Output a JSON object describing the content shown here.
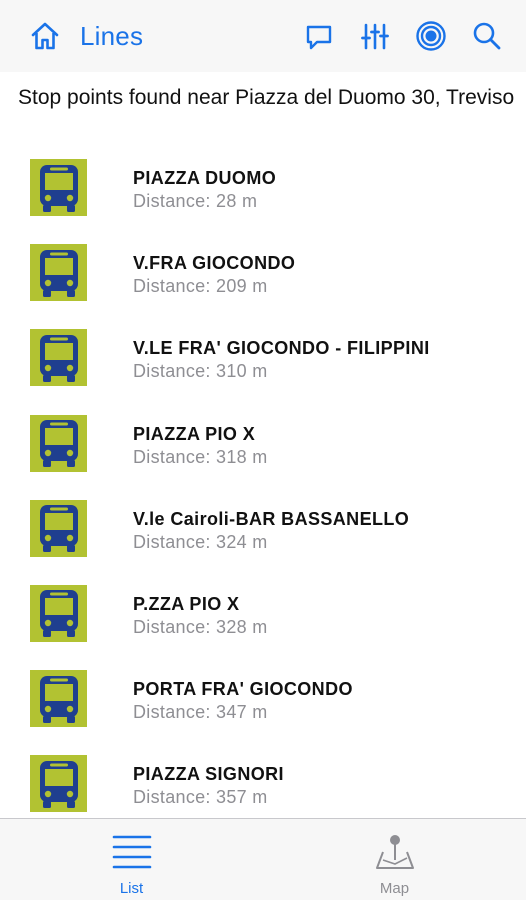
{
  "colors": {
    "accent": "#1a73e8",
    "stop_icon_bg": "#b2c232",
    "bus_body": "#1f3f8f",
    "secondary_text": "#8e8e93"
  },
  "navbar": {
    "title": "Lines",
    "home_icon": "home-icon",
    "actions": [
      "chat-bubble-icon",
      "filter-sliders-icon",
      "location-target-icon",
      "search-icon"
    ]
  },
  "header": {
    "text": "Stop points found near Piazza del Duomo 30, Treviso"
  },
  "stops": [
    {
      "name": "PIAZZA DUOMO",
      "distance": "Distance: 28 m"
    },
    {
      "name": "V.FRA GIOCONDO",
      "distance": "Distance: 209 m"
    },
    {
      "name": "V.LE FRA' GIOCONDO - FILIPPINI",
      "distance": "Distance: 310 m"
    },
    {
      "name": "PIAZZA PIO X",
      "distance": "Distance: 318 m"
    },
    {
      "name": "V.le Cairoli-BAR BASSANELLO",
      "distance": "Distance: 324 m"
    },
    {
      "name": "P.ZZA PIO X",
      "distance": "Distance: 328 m"
    },
    {
      "name": "PORTA FRA' GIOCONDO",
      "distance": "Distance: 347 m"
    },
    {
      "name": "PIAZZA SIGNORI",
      "distance": "Distance: 357 m"
    }
  ],
  "tabs": [
    {
      "label": "List",
      "icon": "list-icon",
      "active": true
    },
    {
      "label": "Map",
      "icon": "map-pin-icon",
      "active": false
    }
  ]
}
